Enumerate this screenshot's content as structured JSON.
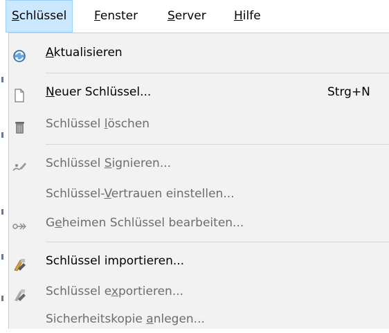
{
  "menubar": {
    "items": [
      {
        "pre": "",
        "mnem": "S",
        "post": "chlüssel"
      },
      {
        "pre": "",
        "mnem": "F",
        "post": "enster"
      },
      {
        "pre": "",
        "mnem": "S",
        "post": "erver"
      },
      {
        "pre": "",
        "mnem": "H",
        "post": "ilfe"
      }
    ]
  },
  "menu": {
    "items": [
      {
        "pre": "",
        "mnem": "A",
        "post": "ktualisieren",
        "shortcut": "",
        "enabled": true,
        "icon": "refresh-icon"
      },
      {
        "pre": "",
        "mnem": "N",
        "post": "euer Schlüssel...",
        "shortcut": "Strg+N",
        "enabled": true,
        "icon": "new-document-icon"
      },
      {
        "pre": "Schlüssel ",
        "mnem": "l",
        "post": "öschen",
        "shortcut": "",
        "enabled": false,
        "icon": "trash-icon"
      },
      {
        "pre": "Schlüssel ",
        "mnem": "S",
        "post": "ignieren...",
        "shortcut": "",
        "enabled": false,
        "icon": "sign-icon"
      },
      {
        "pre": "Schlüssel-",
        "mnem": "V",
        "post": "ertrauen einstellen...",
        "shortcut": "",
        "enabled": false,
        "icon": ""
      },
      {
        "pre": "G",
        "mnem": "e",
        "post": "heimen Schlüssel bearbeiten...",
        "shortcut": "",
        "enabled": false,
        "icon": "secret-key-icon"
      },
      {
        "pre": "Schlüssel importieren...",
        "mnem": "",
        "post": "",
        "shortcut": "",
        "enabled": true,
        "icon": "import-key-icon"
      },
      {
        "pre": "Schlüssel e",
        "mnem": "x",
        "post": "portieren...",
        "shortcut": "",
        "enabled": false,
        "icon": "export-key-icon"
      },
      {
        "pre": "Sicherheitskopie ",
        "mnem": "a",
        "post": "nlegen...",
        "shortcut": "",
        "enabled": false,
        "icon": ""
      }
    ]
  }
}
